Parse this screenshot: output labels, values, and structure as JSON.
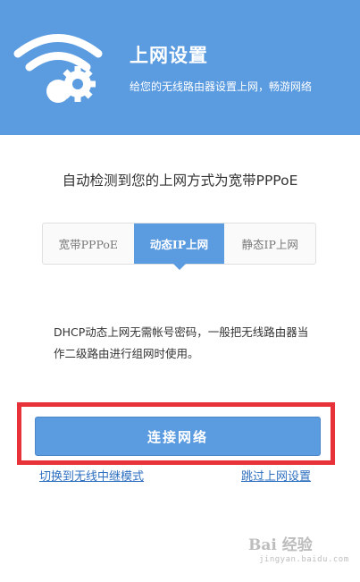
{
  "header": {
    "title": "上网设置",
    "subtitle": "给您的无线路由器设置上网，畅游网络"
  },
  "detect_text": "自动检测到您的上网方式为宽带PPPoE",
  "tabs": [
    {
      "label": "宽带PPPoE",
      "active": false
    },
    {
      "label": "动态IP上网",
      "active": true
    },
    {
      "label": "静态IP上网",
      "active": false
    }
  ],
  "description": "DHCP动态上网无需帐号密码，一般把无线路由器当作二级路由进行组网时使用。",
  "connect_button": "连接网络",
  "links": {
    "repeater": "切换到无线中继模式",
    "skip": "跳过上网设置"
  },
  "watermark": {
    "brand": "Bai 经验",
    "url": "jingyan.baidu.com"
  },
  "colors": {
    "header": "#5b9be0",
    "highlight": "#e8323a",
    "link": "#2e6fc0"
  }
}
